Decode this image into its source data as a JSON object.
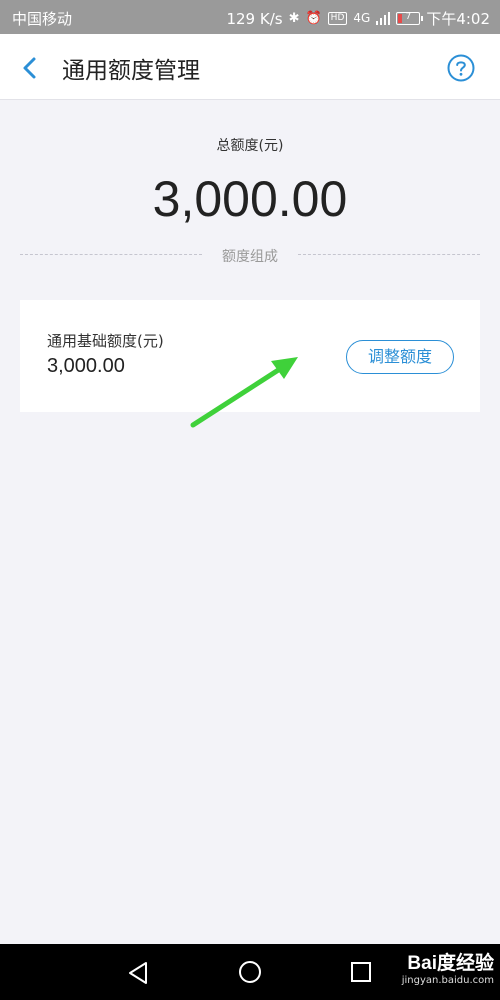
{
  "status_bar": {
    "carrier": "中国移动",
    "speed": "129 K/s",
    "hd": "HD",
    "network": "4G",
    "battery_level": "7",
    "time": "下午4:02"
  },
  "header": {
    "title": "通用额度管理",
    "back_icon": "chevron-left-icon",
    "help_icon": "question-circle-icon"
  },
  "total": {
    "label": "总额度(元)",
    "amount": "3,000.00"
  },
  "composition_divider": "额度组成",
  "card": {
    "label": "通用基础额度(元)",
    "value": "3,000.00",
    "adjust_button": "调整额度"
  },
  "watermark": {
    "brand": "Bai度经验",
    "site": "jingyan.baidu.com"
  },
  "colors": {
    "accent": "#2b8fd6",
    "annotation_arrow": "#3fd13a",
    "background": "#f3f3f8"
  }
}
